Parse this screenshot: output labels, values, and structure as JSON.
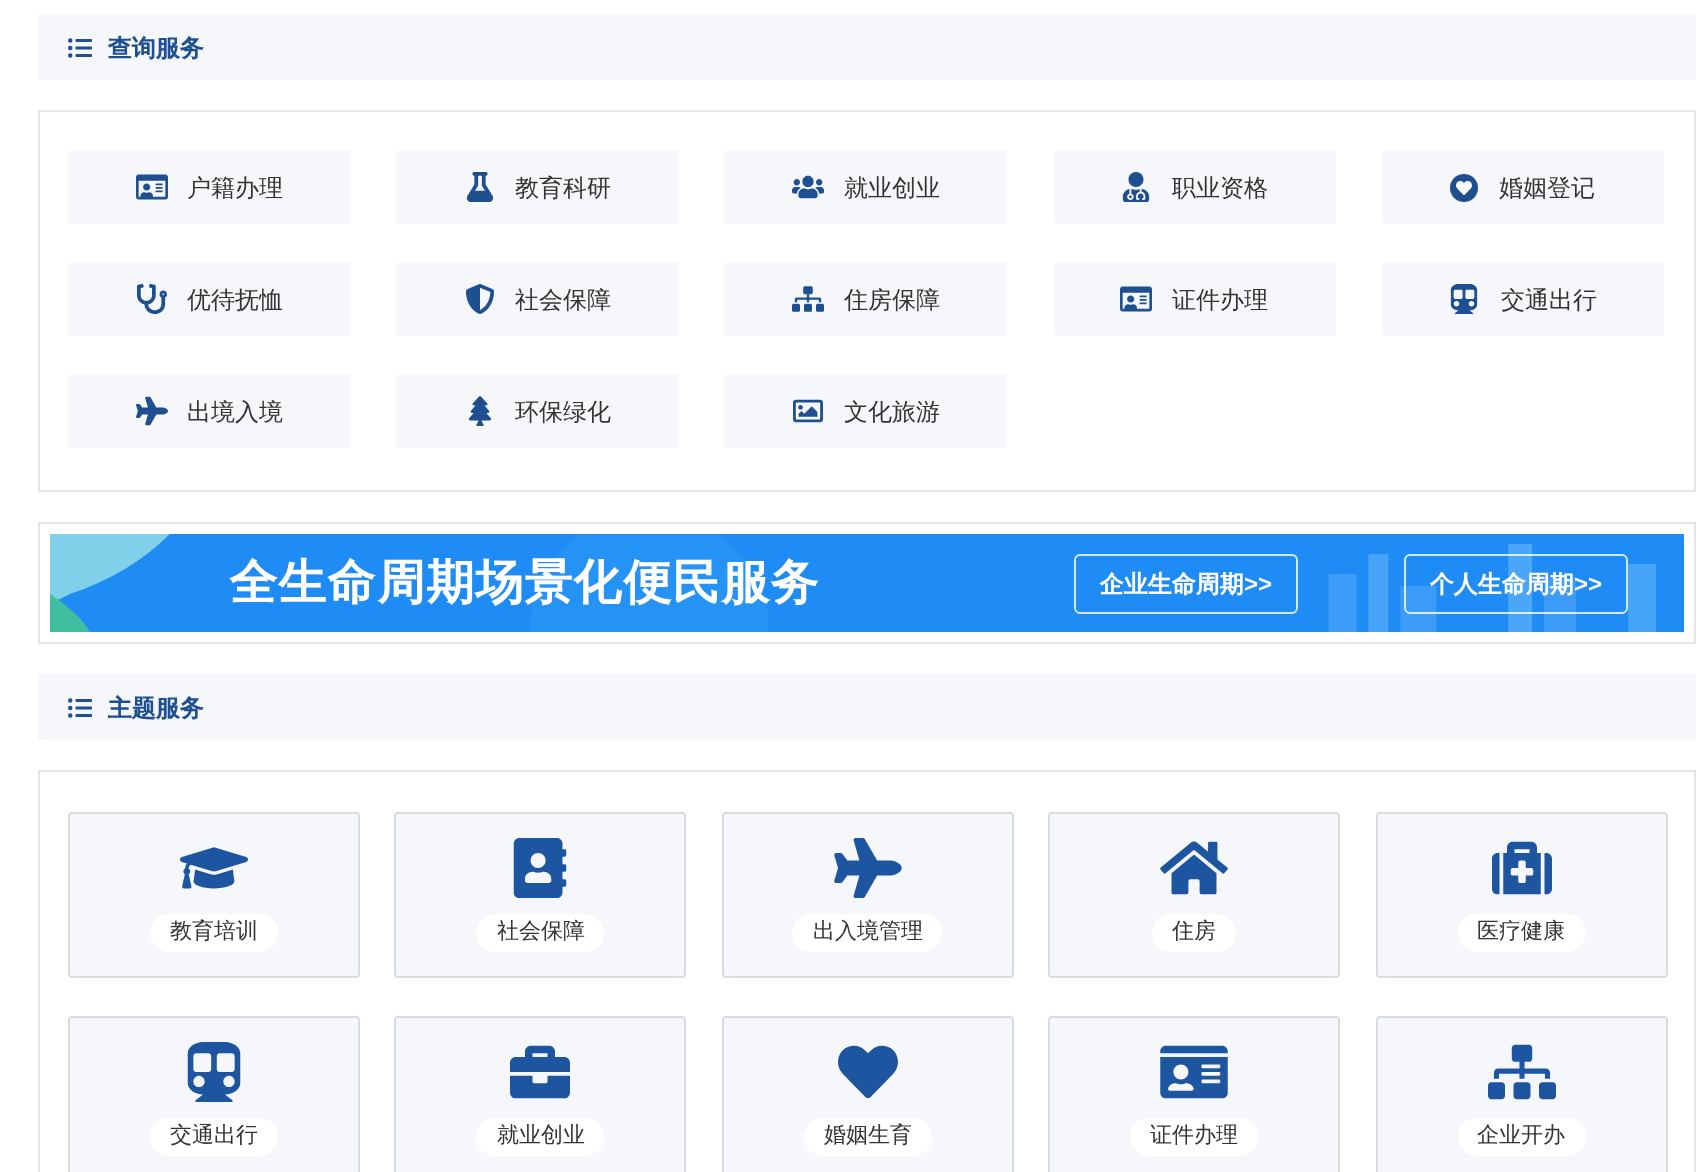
{
  "query_section": {
    "title": "查询服务",
    "items": [
      {
        "label": "户籍办理"
      },
      {
        "label": "教育科研"
      },
      {
        "label": "就业创业"
      },
      {
        "label": "职业资格"
      },
      {
        "label": "婚姻登记"
      },
      {
        "label": "优待抚恤"
      },
      {
        "label": "社会保障"
      },
      {
        "label": "住房保障"
      },
      {
        "label": "证件办理"
      },
      {
        "label": "交通出行"
      },
      {
        "label": "出境入境"
      },
      {
        "label": "环保绿化"
      },
      {
        "label": "文化旅游"
      }
    ]
  },
  "banner": {
    "title": "全生命周期场景化便民服务",
    "buttons": [
      "企业生命周期>>",
      "个人生命周期>>"
    ]
  },
  "theme_section": {
    "title": "主题服务",
    "items": [
      {
        "label": "教育培训"
      },
      {
        "label": "社会保障"
      },
      {
        "label": "出入境管理"
      },
      {
        "label": "住房"
      },
      {
        "label": "医疗健康"
      },
      {
        "label": "交通出行"
      },
      {
        "label": "就业创业"
      },
      {
        "label": "婚姻生育"
      },
      {
        "label": "证件办理"
      },
      {
        "label": "企业开办"
      }
    ]
  }
}
